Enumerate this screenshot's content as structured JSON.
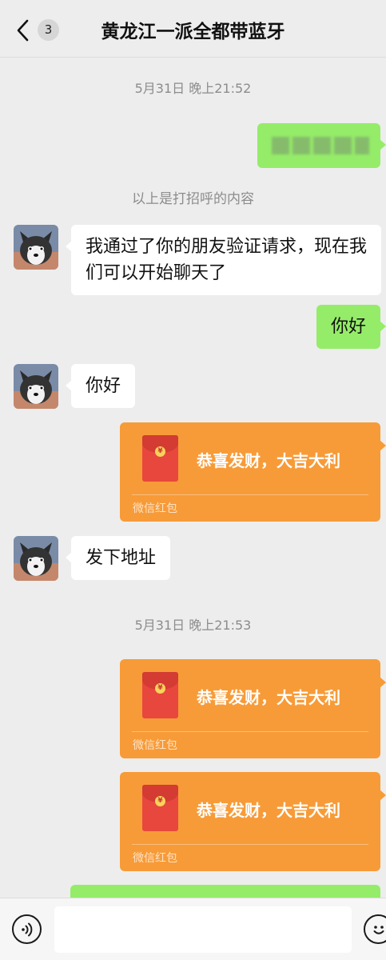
{
  "header": {
    "title": "黄龙江一派全都带蓝牙",
    "unread_count": "3",
    "back_icon": "chevron-left-icon"
  },
  "messages": {
    "timestamp_1": "5月31日 晚上21:52",
    "system_note": "以上是打招呼的内容",
    "in_1": "我通过了你的朋友验证请求，现在我们可以开始聊天了",
    "out_1": "你好",
    "in_2": "你好",
    "packet_1": {
      "title": "恭喜发财，大吉大利",
      "label": "微信红包"
    },
    "in_3": "发下地址",
    "timestamp_2": "5月31日 晚上21:53",
    "packet_2": {
      "title": "恭喜发财，大吉大利",
      "label": "微信红包"
    },
    "packet_3": {
      "title": "恭喜发财，大吉大利",
      "label": "微信红包"
    }
  },
  "input_bar": {
    "placeholder": "",
    "voice_icon": "voice-icon",
    "emoji_icon": "emoji-icon"
  },
  "colors": {
    "background": "#ededed",
    "outgoing_bubble": "#95ec69",
    "incoming_bubble": "#ffffff",
    "red_packet": "#f79b38"
  }
}
